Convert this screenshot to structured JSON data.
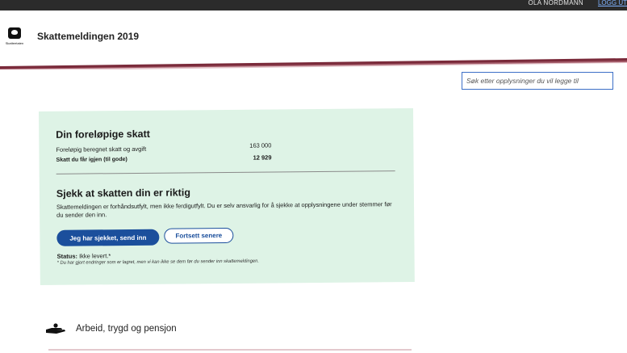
{
  "topbar": {
    "user": "OLA NORDMANN",
    "logout": "LOGG UT"
  },
  "header": {
    "logo_text": "Skatteetaten",
    "title": "Skattemeldingen 2019"
  },
  "colors": {
    "brand_band": "#7a2a3a",
    "card_bg": "#def3e6",
    "primary": "#1b4f9c",
    "search_border": "#3c6fc7"
  },
  "search": {
    "placeholder": "Søk etter opplysninger du vil legge til"
  },
  "tax": {
    "title": "Din foreløpige skatt",
    "rows": [
      {
        "label": "Foreløpig beregnet skatt og avgift",
        "value": "163 000"
      },
      {
        "label": "Skatt du får igjen (til gode)",
        "value": "12 929"
      }
    ]
  },
  "check": {
    "title": "Sjekk at skatten din er riktig",
    "description": "Skattemeldingen er forhåndsutfylt, men ikke ferdigutfylt. Du er selv ansvarlig for å sjekke at opplysningene under stemmer før du sender den inn.",
    "primary_button": "Jeg har sjekket, send inn",
    "secondary_button": "Fortsett senere",
    "status_label": "Status:",
    "status_value": "Ikke levert.*",
    "note": "* Du har gjort endringer som er lagret, men vi kan ikke se dem før du sender inn skattemeldingen."
  },
  "section": {
    "icon": "hand-coin-icon",
    "label": "Arbeid, trygd og pensjon"
  }
}
